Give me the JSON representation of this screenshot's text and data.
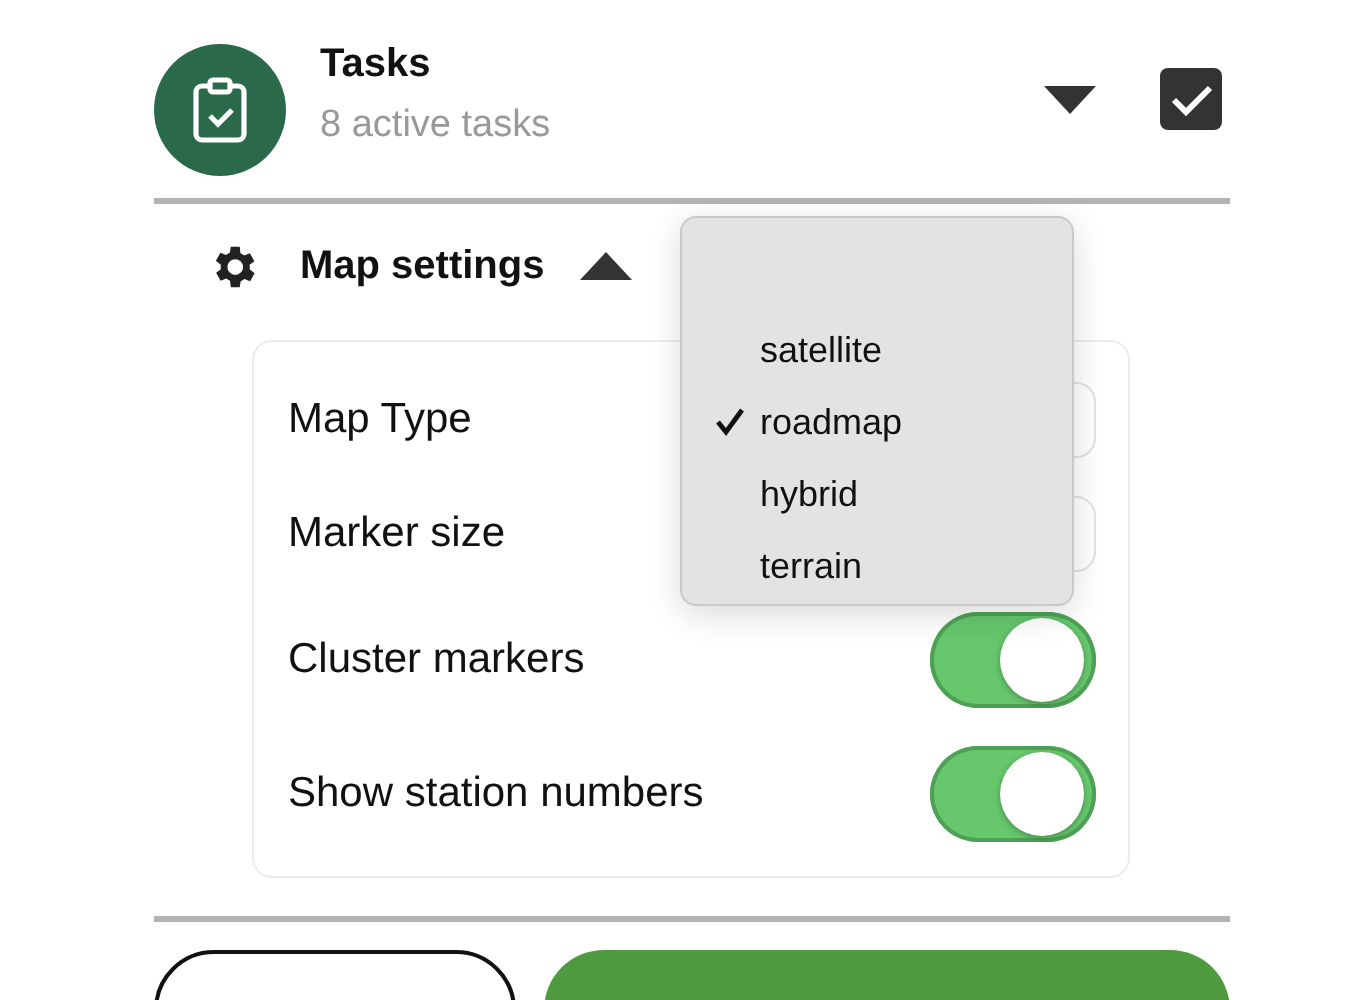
{
  "header": {
    "title": "Tasks",
    "subtitle": "8 active tasks",
    "expanded": false,
    "checked": true
  },
  "section": {
    "title": "Map settings",
    "expanded": true
  },
  "settings": [
    {
      "kind": "select",
      "label": "Map Type"
    },
    {
      "kind": "select",
      "label": "Marker size"
    },
    {
      "kind": "toggle",
      "label": "Cluster markers",
      "on": true
    },
    {
      "kind": "toggle",
      "label": "Show station numbers",
      "on": true
    }
  ],
  "dropdown": {
    "options": [
      {
        "label": "satellite",
        "selected": false
      },
      {
        "label": "roadmap",
        "selected": true
      },
      {
        "label": "hybrid",
        "selected": false
      },
      {
        "label": "terrain",
        "selected": false
      }
    ]
  },
  "buttons": [
    {
      "kind": "outline"
    },
    {
      "kind": "primary"
    }
  ]
}
